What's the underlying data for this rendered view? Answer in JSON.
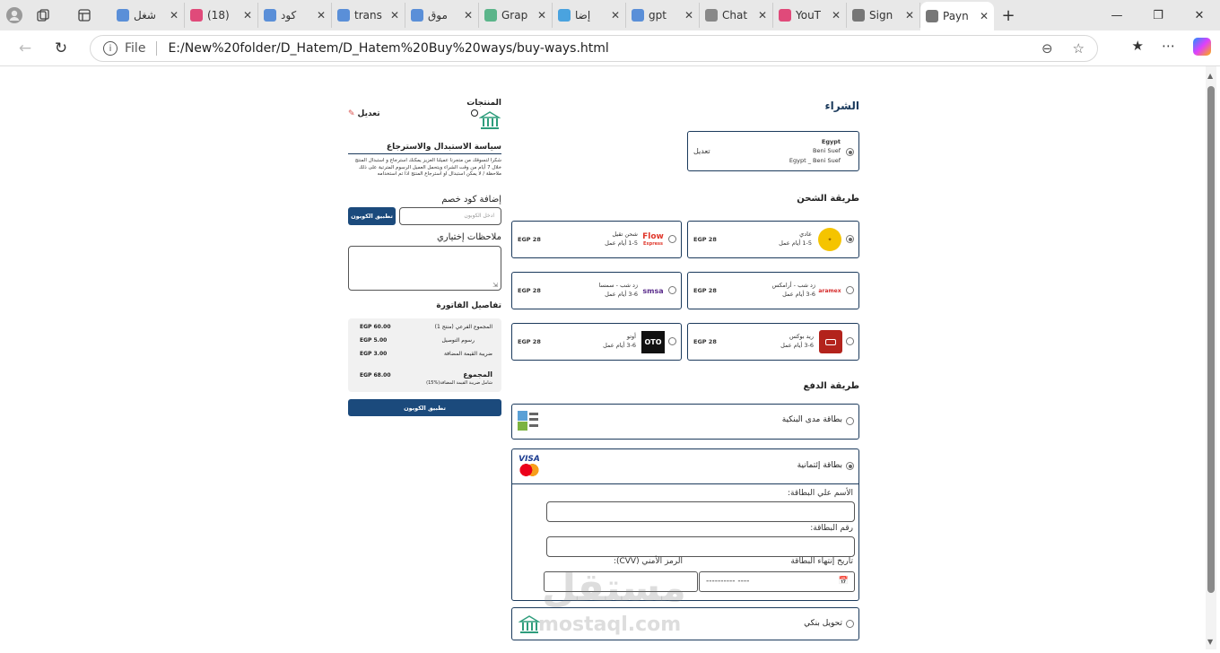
{
  "browser": {
    "tabs": [
      {
        "title": "شغل",
        "fav": "search-icon",
        "color": "#5a8fd8"
      },
      {
        "title": "(18)",
        "fav": "youtube-icon",
        "color": "#e04a7a"
      },
      {
        "title": "كود",
        "fav": "search-icon",
        "color": "#5a8fd8"
      },
      {
        "title": "trans",
        "fav": "search-icon",
        "color": "#5a8fd8"
      },
      {
        "title": "موق",
        "fav": "search-icon",
        "color": "#5a8fd8"
      },
      {
        "title": "Grap",
        "fav": "grapher-icon",
        "color": "#5bb58a"
      },
      {
        "title": "إضا",
        "fav": "gear-icon",
        "color": "#4aa3df"
      },
      {
        "title": "gpt",
        "fav": "search-icon",
        "color": "#5a8fd8"
      },
      {
        "title": "Chat",
        "fav": "chatgpt-icon",
        "color": "#888888"
      },
      {
        "title": "YouT",
        "fav": "youtube-icon",
        "color": "#e04a7a"
      },
      {
        "title": "Sign",
        "fav": "page-icon",
        "color": "#777777"
      },
      {
        "title": "Payn",
        "fav": "page-icon",
        "color": "#777777"
      }
    ],
    "file_label": "File",
    "url": "E:/New%20folder/D_Hatem/D_Hatem%20Buy%20ways/buy-ways.html"
  },
  "checkout": {
    "title": "الشراء",
    "address": {
      "country": "Egypt",
      "city": "Beni Suef",
      "full": "Egypt _ Beni Suef",
      "edit": "تعديل"
    },
    "shipping_title": "طريقة الشحن",
    "shipping": [
      {
        "name": "عادي",
        "days": "1-5 أيام عمل",
        "price": "EGP 28",
        "logo": "aramex-yellow-logo",
        "selected": true
      },
      {
        "name": "شحن تقيل",
        "days": "1-5 أيام عمل",
        "price": "EGP 28",
        "logo": "flow-express-logo",
        "selected": false
      },
      {
        "name": "زد شب - أرامكس",
        "days": "3-6 أيام عمل",
        "price": "EGP 28",
        "logo": "aramex-logo",
        "selected": false
      },
      {
        "name": "زد شب - سمسا",
        "days": "3-6 أيام عمل",
        "price": "EGP 28",
        "logo": "smsa-logo",
        "selected": false
      },
      {
        "name": "ريد بوكس",
        "days": "3-6 أيام عمل",
        "price": "EGP 28",
        "logo": "redbox-logo",
        "selected": false
      },
      {
        "name": "أوتو",
        "days": "3-6 أيام عمل",
        "price": "EGP 28",
        "logo": "oto-logo",
        "selected": false
      }
    ],
    "logo_texts": {
      "flow": "Flow",
      "flow_sub": "Express",
      "aramex": "aramex",
      "smsa": "smsa",
      "oto": "OTO",
      "visa": "VISA",
      "mastercard": "MasterCard"
    },
    "payment_title": "طريقة الدفع",
    "payment": {
      "mada": "بطاقة مدى البنكية",
      "credit": "بطاقة إئتمانية",
      "bank": "تحويل بنكي",
      "card_name_label": "الأسم علي البطاقة:",
      "card_number_label": "رقم البطاقة:",
      "expiry_label": "تاريخ إنتهاء البطاقة",
      "expiry_placeholder": "---------- ----",
      "cvv_label": "الرمز الأمني (CVV):"
    }
  },
  "sidebar": {
    "products_title": "المنتجات",
    "edit": "تعديل",
    "policy_title": "سياسة الاستبدال والاسترجاع",
    "policy_text": "شكرا لتسوقك من متجرنا عميلنا العزيز يمكنك استرجاع و استبدال المنتج خلال 7 أيام من وقت الشراء ويتحمل العميل الرسوم المترتبة على ذلك ملاحظة / لا يمكن استبدال او استرجاع المنتج اذا تم استخدامه",
    "coupon_title": "إضافة كود خصم",
    "coupon_placeholder": "ادخل الكوبون",
    "coupon_apply": "تطبيق الكوبون",
    "notes_title": "ملاحظات إختياري",
    "invoice_title": "تفاصيل الفاتورة",
    "invoice_rows": [
      {
        "label": "المجموع الفرعي (منتج 1)",
        "value": "EGP 60.00"
      },
      {
        "label": "رسوم التوصيل",
        "value": "EGP 5.00"
      },
      {
        "label": "ضريبة القيمة المضافة",
        "value": "EGP 3.00"
      }
    ],
    "total_label": "المجموع",
    "total_note": "شامل ضريبة القيمة المضافة(%15)",
    "total_value": "EGP 68.00",
    "bottom_button": "تطبيق الكوبون"
  },
  "watermark": {
    "arabic": "مستقل",
    "latin": "mostaql.com"
  }
}
